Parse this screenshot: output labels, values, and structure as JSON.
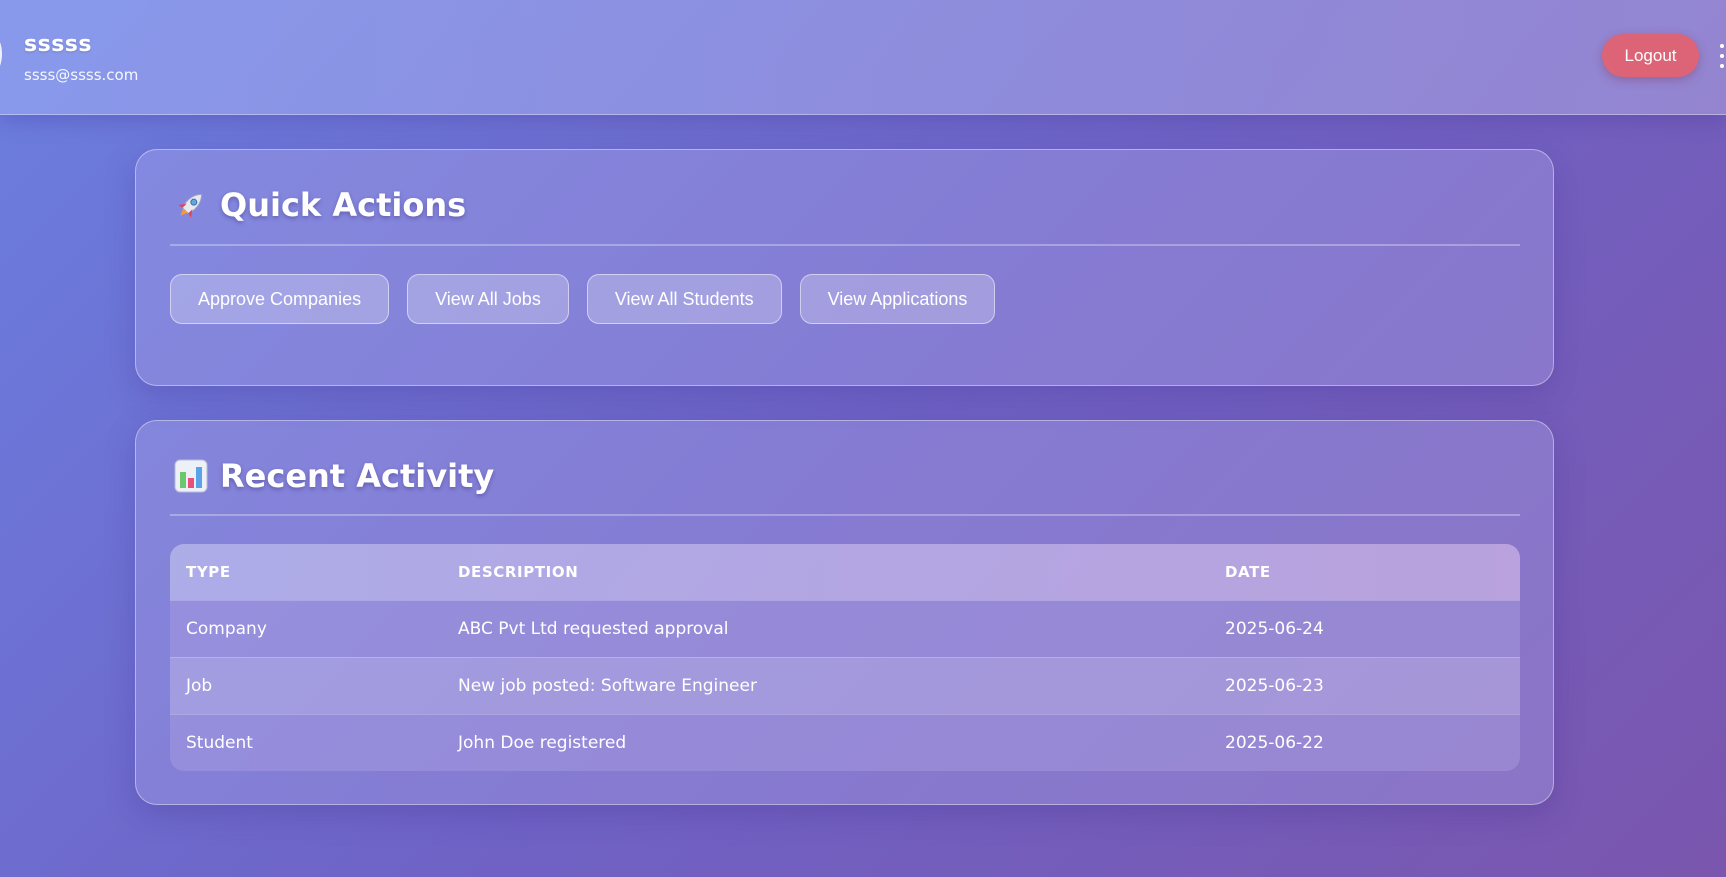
{
  "header": {
    "user_name": "sssss",
    "user_email": "ssss@ssss.com",
    "logout_label": "Logout"
  },
  "quick_actions": {
    "icon": "rocket-icon",
    "title": "Quick Actions",
    "buttons": [
      {
        "label": "Approve Companies"
      },
      {
        "label": "View All Jobs"
      },
      {
        "label": "View All Students"
      },
      {
        "label": "View Applications"
      }
    ]
  },
  "recent_activity": {
    "icon": "bar-chart-icon",
    "title": "Recent Activity",
    "columns": [
      "TYPE",
      "DESCRIPTION",
      "DATE"
    ],
    "rows": [
      {
        "type": "Company",
        "description": "ABC Pvt Ltd requested approval",
        "date": "2025-06-24"
      },
      {
        "type": "Job",
        "description": "New job posted: Software Engineer",
        "date": "2025-06-23"
      },
      {
        "type": "Student",
        "description": "John Doe registered",
        "date": "2025-06-22"
      }
    ]
  },
  "colors": {
    "logout_button": "#dd6476",
    "background_start": "#6b7fe0",
    "background_end": "#7a56ae"
  }
}
